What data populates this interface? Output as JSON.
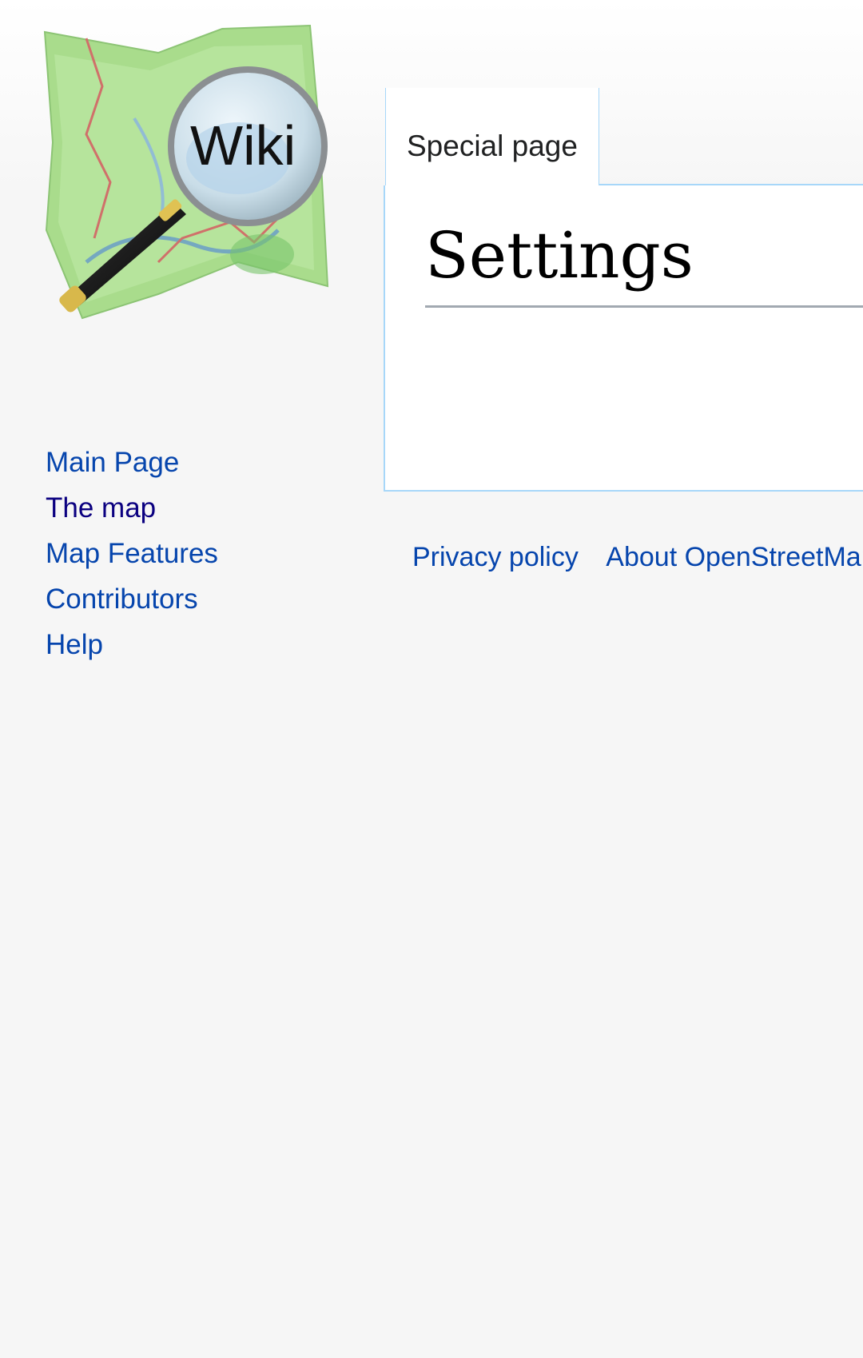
{
  "logo": {
    "text": "Wiki"
  },
  "tabs": [
    {
      "label": "Special page"
    }
  ],
  "page": {
    "title": "Settings"
  },
  "sidebar": {
    "items": [
      {
        "label": "Main Page"
      },
      {
        "label": "The map"
      },
      {
        "label": "Map Features"
      },
      {
        "label": "Contributors"
      },
      {
        "label": "Help"
      }
    ]
  },
  "footer": {
    "links": [
      {
        "label": "Privacy policy"
      },
      {
        "label": "About OpenStreetMap"
      }
    ]
  },
  "colors": {
    "link": "#0645ad",
    "visited_link": "#0b0080",
    "border": "#a7d7f9",
    "background": "#f6f6f6"
  }
}
